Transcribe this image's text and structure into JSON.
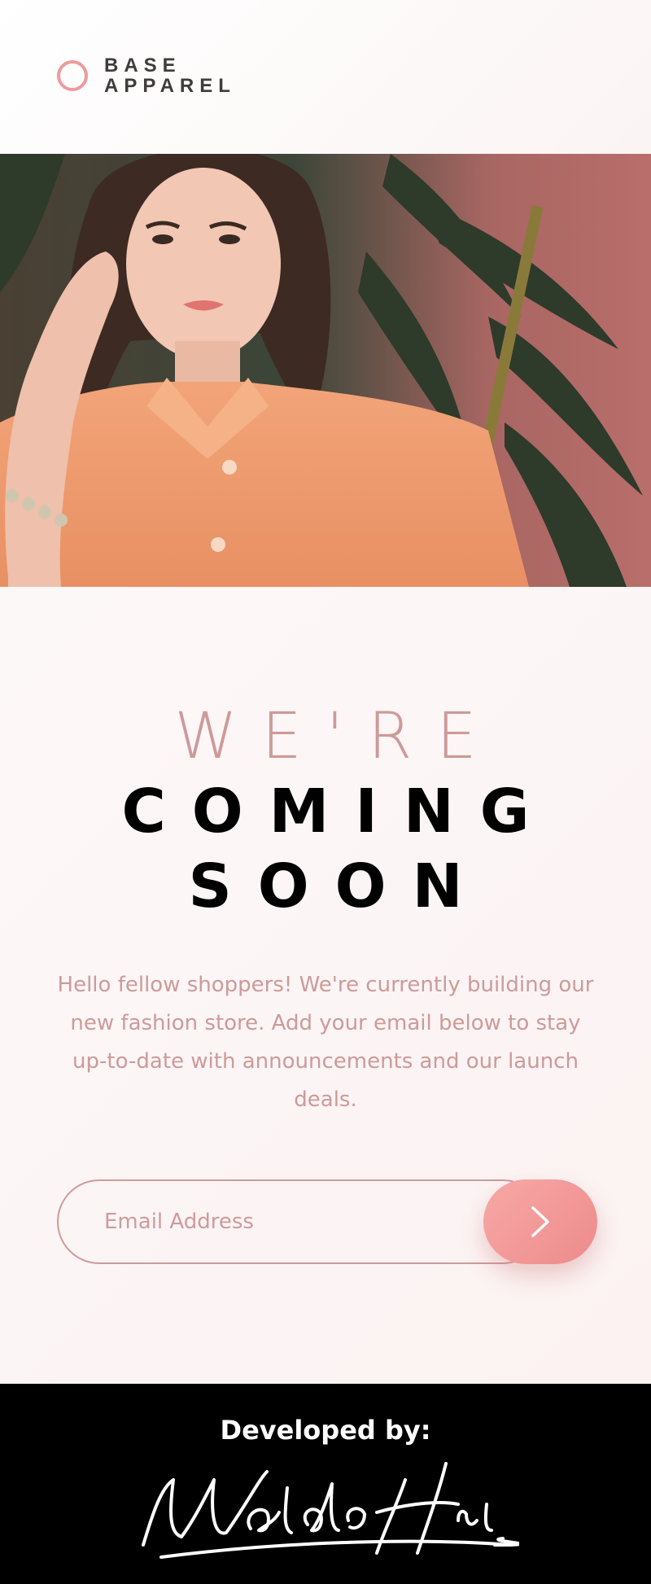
{
  "header": {
    "brand_line1": "BASE",
    "brand_line2": "APPAREL",
    "accent_color": "#ee9a9c"
  },
  "hero": {
    "image_icon": "model-photo"
  },
  "main": {
    "title_light": "WE'RE",
    "title_bold_line1": "COMING",
    "title_bold_line2": "SOON",
    "description": "Hello fellow shoppers! We're currently building our new fashion store. Add your email below to stay up-to-date with announcements and our launch deals.",
    "email_placeholder": "Email Address",
    "submit_icon": "chevron-right-icon",
    "text_color": "#cd9a99"
  },
  "footer": {
    "developed_label": "Developed by:",
    "signature": "Waldo Hidalgo."
  }
}
